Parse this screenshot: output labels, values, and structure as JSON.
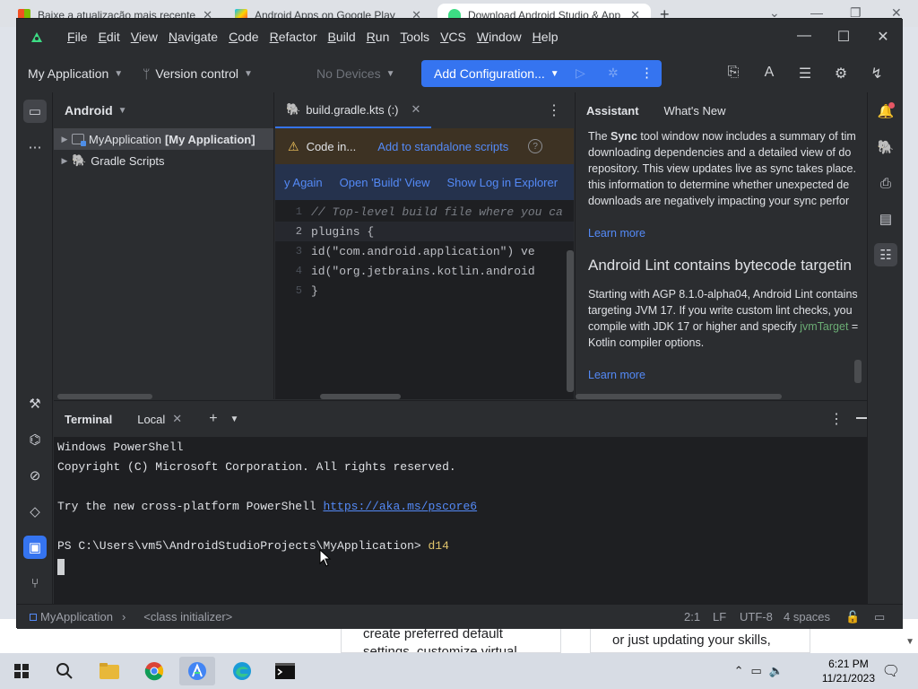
{
  "browser": {
    "tabs": [
      {
        "title": "Baixe a atualização mais recente",
        "close": "✕"
      },
      {
        "title": "Android Apps on Google Play",
        "close": "✕"
      },
      {
        "title": "Download Android Studio & App",
        "close": "✕"
      }
    ],
    "new_tab": "+"
  },
  "webpage": {
    "card1": "create preferred default",
    "card1b": "settings, customize virtual",
    "card2": "or just updating your skills,"
  },
  "menu": [
    "File",
    "Edit",
    "View",
    "Navigate",
    "Code",
    "Refactor",
    "Build",
    "Run",
    "Tools",
    "VCS",
    "Window",
    "Help"
  ],
  "toolbar": {
    "project": "My Application",
    "vcs": "Version control",
    "devices": "No Devices",
    "add_config": "Add Configuration..."
  },
  "project_panel": {
    "view": "Android",
    "items": [
      {
        "name": "MyApplication",
        "bold": "[My Application]"
      },
      {
        "name": "Gradle Scripts"
      }
    ]
  },
  "editor": {
    "tab": "build.gradle.kts (:)",
    "banner_text": "Code in...",
    "banner_link": "Add to standalone scripts",
    "sync_links": [
      "y Again",
      "Open 'Build' View",
      "Show Log in Explorer"
    ],
    "lines": [
      {
        "n": "1",
        "t": "// Top-level build file where you ca"
      },
      {
        "n": "2",
        "t": "plugins {"
      },
      {
        "n": "3",
        "t": "    id(\"com.android.application\") ve"
      },
      {
        "n": "4",
        "t": "    id(\"org.jetbrains.kotlin.android"
      },
      {
        "n": "5",
        "t": "}"
      }
    ]
  },
  "assistant": {
    "tabs": [
      "Assistant",
      "What's New"
    ],
    "p1_pre": "The ",
    "p1_bold": "Sync",
    "p1_post": " tool window now includes a summary of tim",
    "p1_l2": "downloading dependencies and a detailed view of do",
    "p1_l3": "repository. This view updates live as sync takes place.",
    "p1_l4": "this information to determine whether unexpected de",
    "p1_l5": "downloads are negatively impacting your sync perfor",
    "learn_more": "Learn more",
    "heading": "Android Lint contains bytecode targetin",
    "p2_l1": "Starting with AGP 8.1.0-alpha04, Android Lint contains",
    "p2_l2": "targeting JVM 17. If you write custom lint checks, you",
    "p2_l3_pre": "compile with JDK 17 or higher and specify ",
    "p2_l3_code": "jvmTarget",
    "p2_l3_post": " =",
    "p2_l4": "Kotlin compiler options.",
    "learn_more2": "Learn more"
  },
  "terminal": {
    "title": "Terminal",
    "tab": "Local",
    "lines": [
      "Windows PowerShell",
      "Copyright (C) Microsoft Corporation. All rights reserved.",
      "",
      "Try the new cross-platform PowerShell "
    ],
    "link": "https://aka.ms/pscore6",
    "prompt": "PS C:\\Users\\vm5\\AndroidStudioProjects\\MyApplication> ",
    "command": "d14"
  },
  "statusbar": {
    "module": "MyApplication",
    "context": "<class initializer>",
    "position": "2:1",
    "line_sep": "LF",
    "encoding": "UTF-8",
    "indent": "4 spaces"
  },
  "taskbar": {
    "time": "6:21 PM",
    "date": "11/21/2023"
  },
  "colors": {
    "accent": "#3574f0",
    "ide_bg": "#2b2d30",
    "editor_bg": "#1e1f22",
    "link": "#548af7",
    "string": "#6aab73"
  }
}
